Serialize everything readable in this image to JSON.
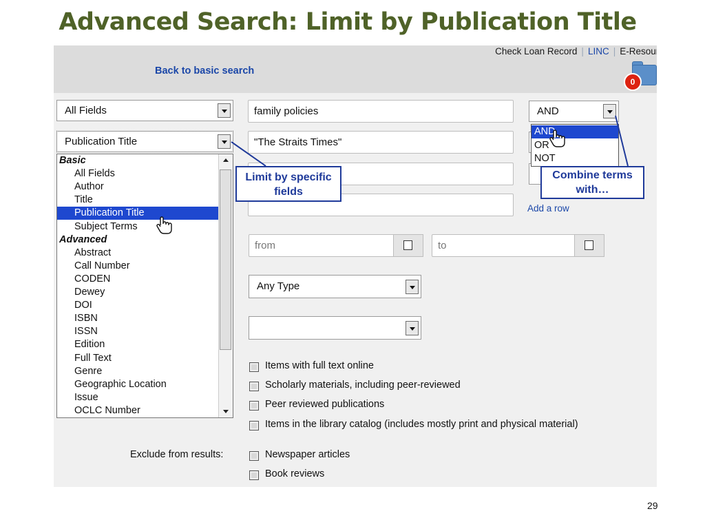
{
  "slide": {
    "title": "Advanced Search: Limit by Publication Title",
    "page_number": "29"
  },
  "topbar": {
    "links": [
      "Check Loan Record",
      "LINC",
      "E-Resourc"
    ],
    "back_link": "Back to basic search",
    "folder_count": "0"
  },
  "rows": [
    {
      "field": "All Fields",
      "term": "family policies",
      "operator": "AND"
    },
    {
      "field": "Publication Title",
      "term": "\"The Straits Times\"",
      "operator": ""
    },
    {
      "field": "",
      "term": "",
      "operator": ""
    },
    {
      "field": "",
      "term": "",
      "operator": ""
    }
  ],
  "add_row_label": "Add a row",
  "field_dropdown": {
    "items": [
      {
        "label": "Basic",
        "type": "group"
      },
      {
        "label": "All Fields",
        "type": "option"
      },
      {
        "label": "Author",
        "type": "option"
      },
      {
        "label": "Title",
        "type": "option"
      },
      {
        "label": "Publication Title",
        "type": "option",
        "selected": true
      },
      {
        "label": "Subject Terms",
        "type": "option"
      },
      {
        "label": "Advanced",
        "type": "group"
      },
      {
        "label": "Abstract",
        "type": "option"
      },
      {
        "label": "Call Number",
        "type": "option"
      },
      {
        "label": "CODEN",
        "type": "option"
      },
      {
        "label": "Dewey",
        "type": "option"
      },
      {
        "label": "DOI",
        "type": "option"
      },
      {
        "label": "ISBN",
        "type": "option"
      },
      {
        "label": "ISSN",
        "type": "option"
      },
      {
        "label": "Edition",
        "type": "option"
      },
      {
        "label": "Full Text",
        "type": "option"
      },
      {
        "label": "Genre",
        "type": "option"
      },
      {
        "label": "Geographic Location",
        "type": "option"
      },
      {
        "label": "Issue",
        "type": "option"
      },
      {
        "label": "OCLC Number",
        "type": "option"
      }
    ]
  },
  "operator_dropdown": {
    "options": [
      "AND",
      "OR",
      "NOT"
    ],
    "selected": "AND"
  },
  "date_range": {
    "from_placeholder": "from",
    "to_placeholder": "to"
  },
  "type_select": {
    "value": "Any Type"
  },
  "second_select": {
    "value": ""
  },
  "limits": [
    "Items with full text online",
    "Scholarly materials, including peer-reviewed",
    "Peer reviewed publications",
    "Items in the library catalog (includes mostly print and physical material)"
  ],
  "exclude": {
    "label": "Exclude from results:",
    "items": [
      "Newspaper articles",
      "Book reviews"
    ]
  },
  "callouts": {
    "fields": "Limit by specific fields",
    "operators": "Combine terms with…"
  },
  "colors": {
    "title": "#4f6228",
    "link": "#1b47a8",
    "highlight": "#1e48cf",
    "callout": "#1f3a9a"
  }
}
